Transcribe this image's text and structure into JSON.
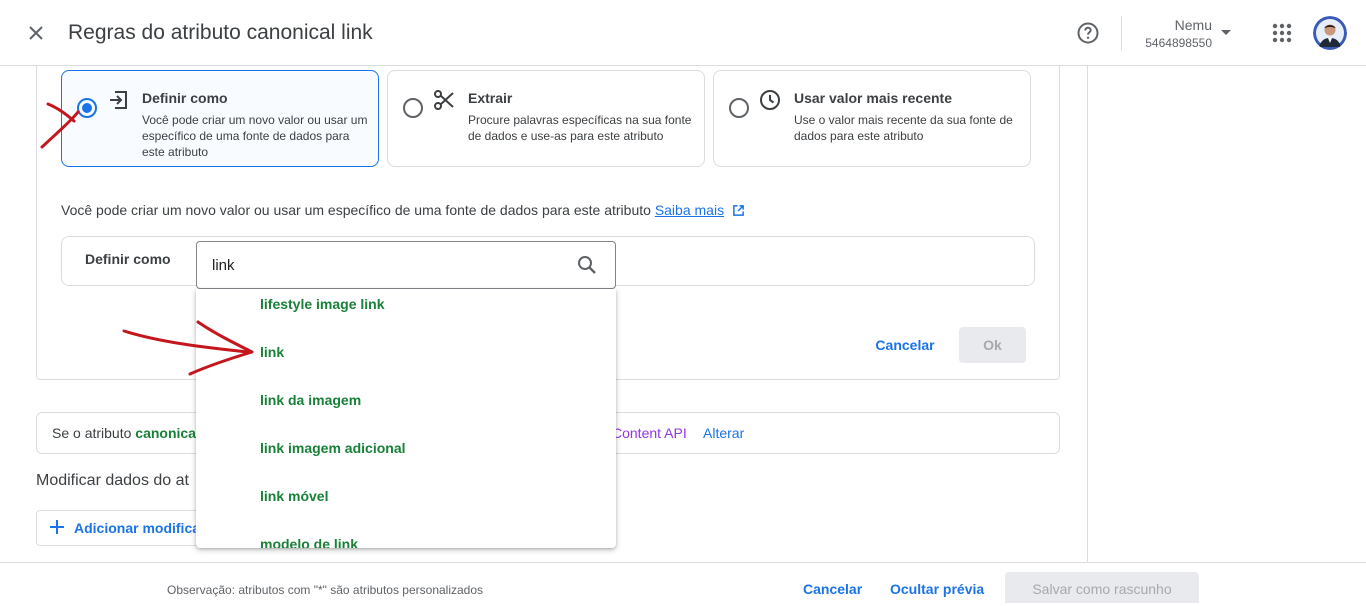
{
  "header": {
    "title": "Regras do atributo canonical link",
    "account_name": "Nemu",
    "account_id": "5464898550"
  },
  "options": [
    {
      "title": "Definir como",
      "description": "Você pode criar um novo valor ou usar um específico de uma fonte de dados para este atributo",
      "selected": true,
      "icon": "input-arrow-icon"
    },
    {
      "title": "Extrair",
      "description": "Procure palavras específicas na sua fonte de dados e use-as para este atributo",
      "selected": false,
      "icon": "scissors-icon"
    },
    {
      "title": "Usar valor mais recente",
      "description": "Use o valor mais recente da sua fonte de dados para este atributo",
      "selected": false,
      "icon": "clock-icon"
    }
  ],
  "info": {
    "text": "Você pode criar um novo valor ou usar um específico de uma fonte de dados para este atributo",
    "link": "Saiba mais"
  },
  "define": {
    "label": "Definir como",
    "search_value": "link"
  },
  "dropdown": {
    "items": [
      "lifestyle image link",
      "link",
      "link da imagem",
      "link imagem adicional",
      "link móvel",
      "modelo de link"
    ]
  },
  "actions": {
    "cancel": "Cancelar",
    "ok": "Ok"
  },
  "rule": {
    "prefix": "Se o atributo ",
    "attribute": "canonica",
    "suffix": "Content API",
    "change": "Alterar"
  },
  "modify": {
    "heading": "Modificar dados do at",
    "add_label": "Adicionar modifica"
  },
  "footer": {
    "note": "Observação: atributos com \"*\" são atributos personalizados",
    "cancel": "Cancelar",
    "hide_preview": "Ocultar prévia",
    "save_draft": "Salvar como rascunho"
  },
  "colors": {
    "accent": "#1a73e8",
    "attribute_green": "#188038",
    "api_purple": "#9334e6",
    "annotation_red": "#c5161d"
  }
}
